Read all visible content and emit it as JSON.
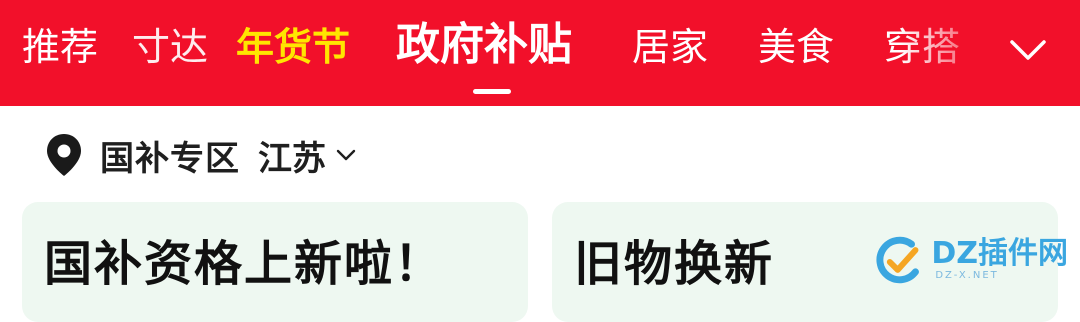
{
  "tabs": [
    {
      "label": "推荐"
    },
    {
      "label": "寸达"
    },
    {
      "label": "年货节"
    },
    {
      "label": "政府补贴"
    },
    {
      "label": "居家"
    },
    {
      "label": "美食"
    },
    {
      "label": "穿搭"
    }
  ],
  "colors": {
    "tabbar_bg": "#f2102a",
    "festival_text": "#ffe600",
    "card_bg": "#eef8f1"
  },
  "icons": {
    "expand": "chevron-down-icon",
    "location": "location-pin-icon",
    "region_dropdown": "chevron-down-icon"
  },
  "region": {
    "title": "国补专区",
    "value": "江苏"
  },
  "cards": [
    {
      "title": "国补资格上新啦！"
    },
    {
      "title": "旧物换新"
    }
  ],
  "watermark": {
    "text": "DZ插件网",
    "sub": "DZ-X.NET"
  }
}
